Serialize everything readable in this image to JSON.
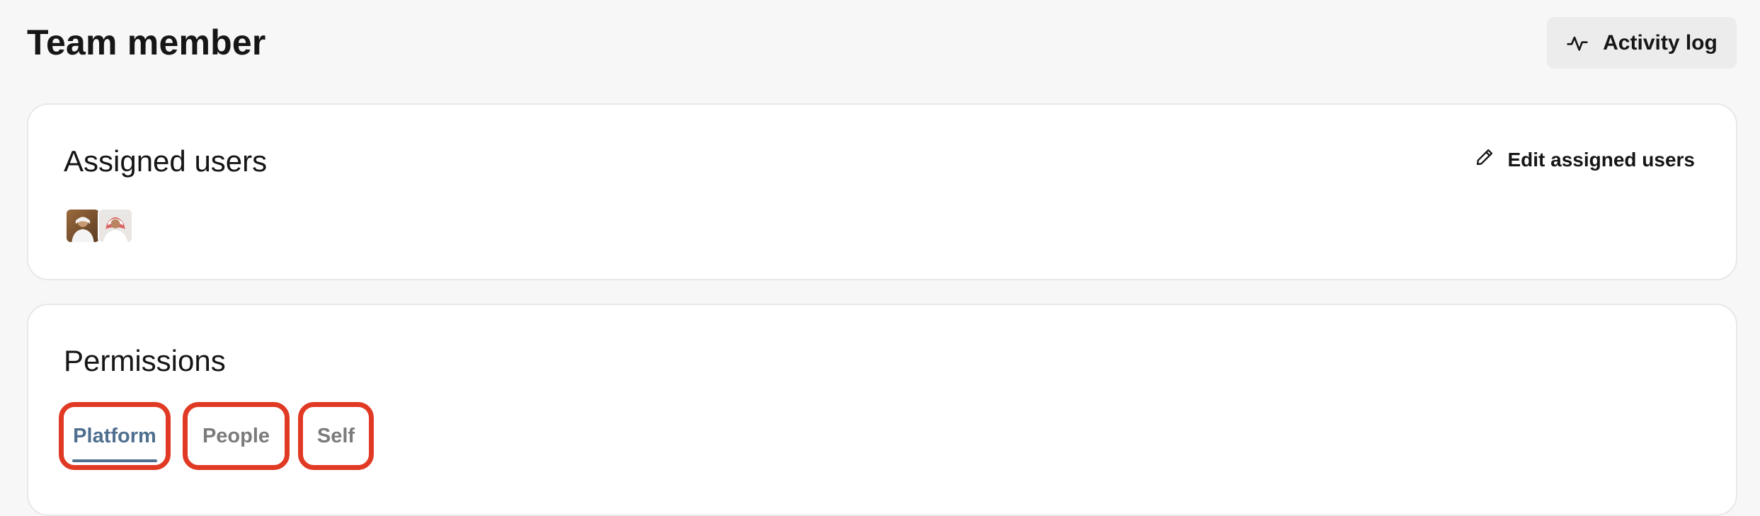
{
  "header": {
    "title": "Team member",
    "activity_log_label": "Activity log"
  },
  "assigned_users": {
    "title": "Assigned users",
    "edit_label": "Edit assigned users",
    "avatars": [
      "avatar-user-1",
      "avatar-user-2"
    ]
  },
  "permissions": {
    "title": "Permissions",
    "tabs": [
      {
        "label": "Platform",
        "active": true
      },
      {
        "label": "People",
        "active": false
      },
      {
        "label": "Self",
        "active": false
      }
    ]
  },
  "colors": {
    "accent": "#4f6f8f",
    "highlight": "#e13a24",
    "background": "#f7f7f7",
    "card": "#ffffff"
  },
  "icons": {
    "activity": "activity-pulse-icon",
    "edit": "pencil-icon"
  }
}
